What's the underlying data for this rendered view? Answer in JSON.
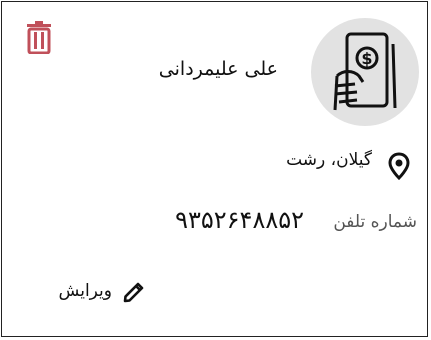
{
  "contact": {
    "name": "علی علیمردانی",
    "location": "گیلان، رشت",
    "phone_label": "شماره تلفن",
    "phone_value": "۹۳۵۲۶۴۸۸۵۲"
  },
  "actions": {
    "edit_label": "ویرایش"
  },
  "icons": {
    "delete": "trash-icon",
    "avatar": "hand-holding-phone-dollar-icon",
    "location": "map-pin-icon",
    "edit": "pencil-icon"
  },
  "colors": {
    "delete_icon": "#c0505a",
    "avatar_bg": "#e2e2e2",
    "text": "#111111",
    "muted_text": "#555555",
    "border": "#222222"
  }
}
